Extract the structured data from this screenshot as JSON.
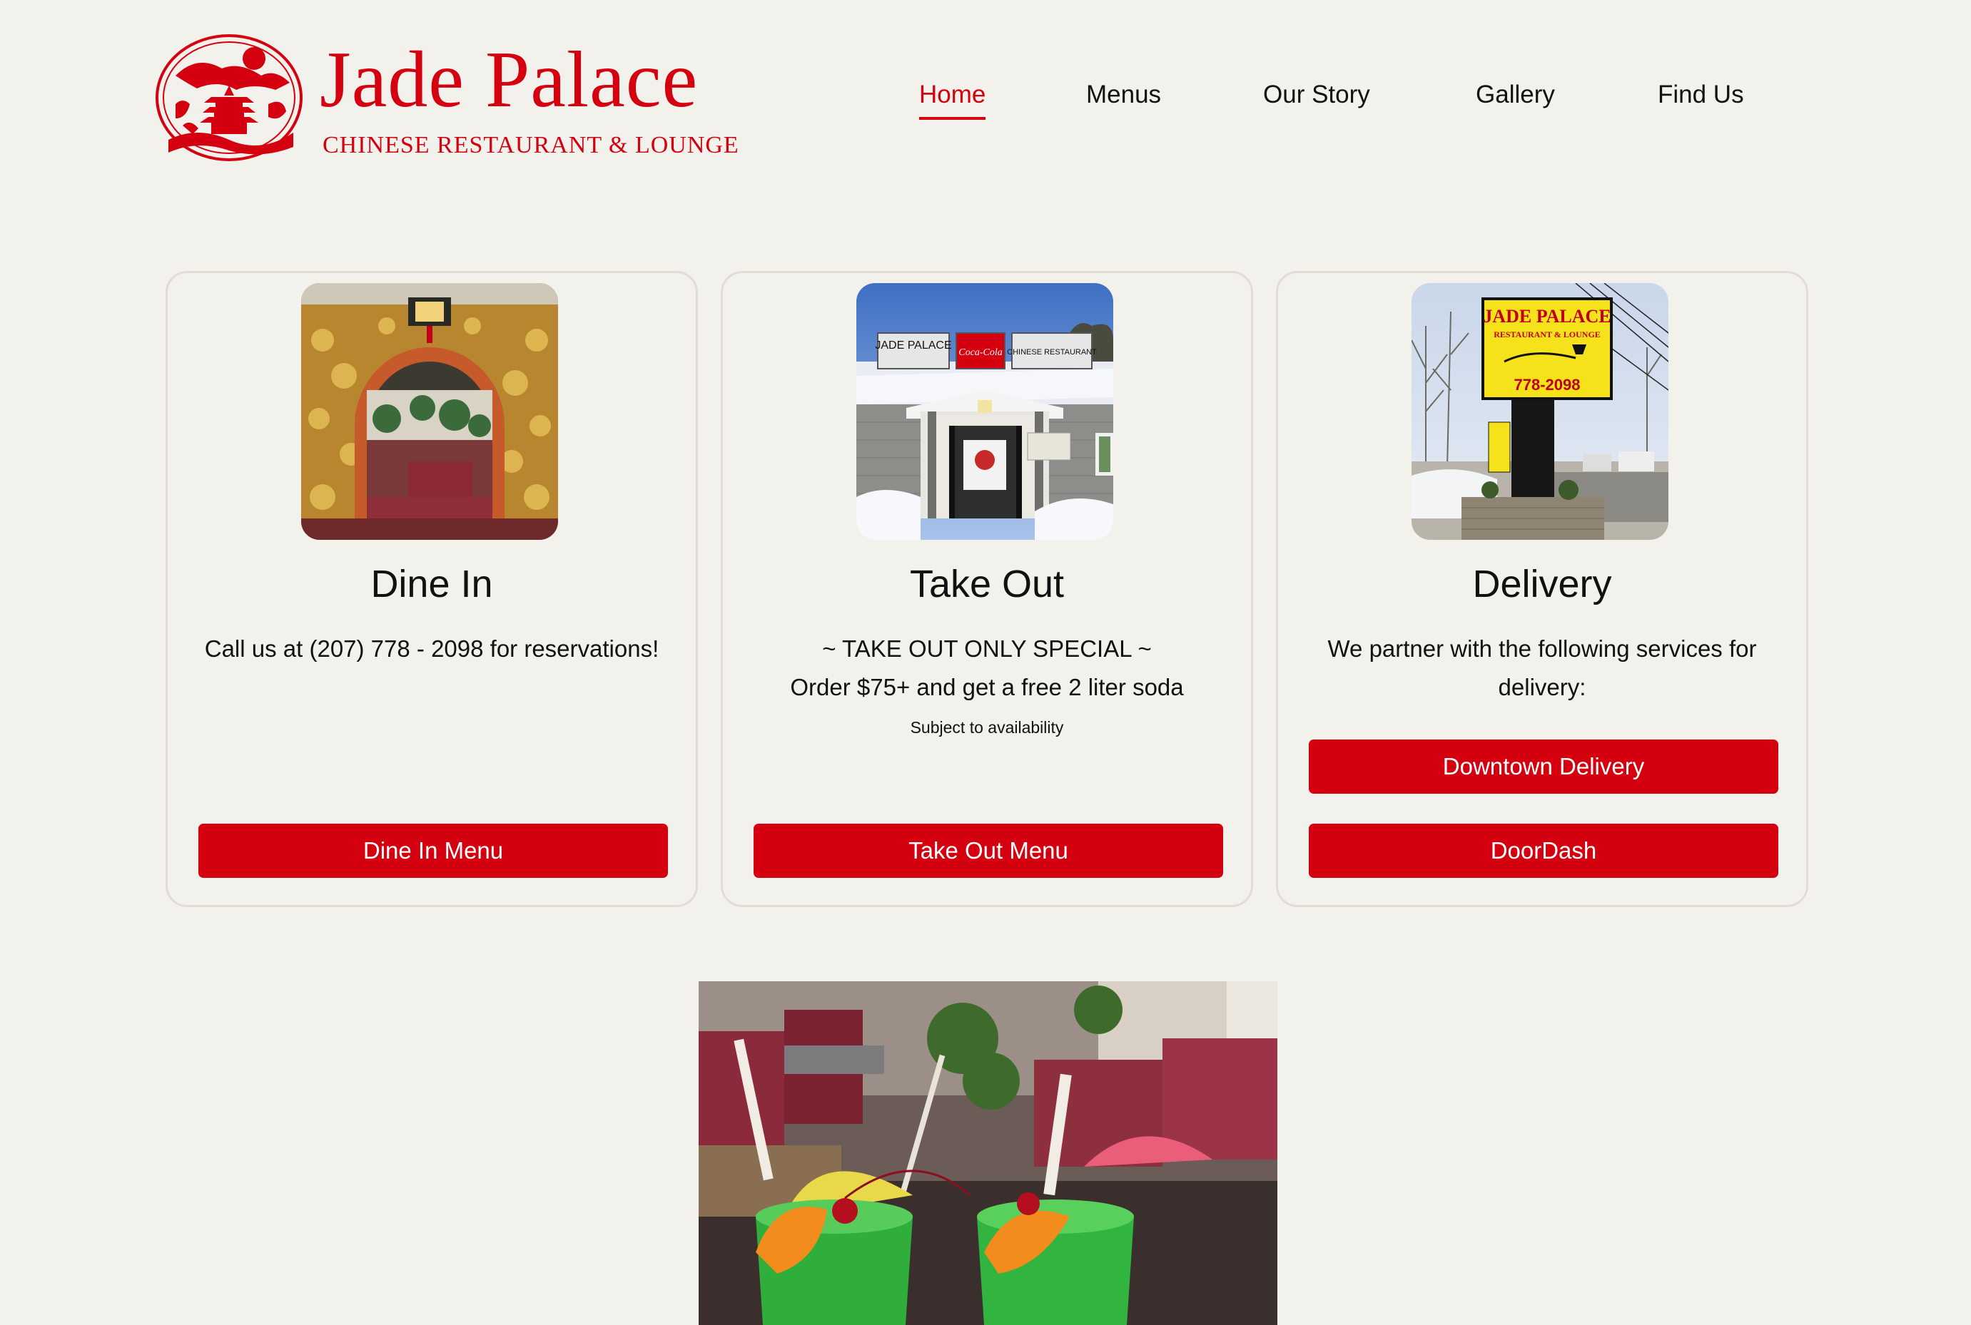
{
  "brand": {
    "name": "Jade Palace",
    "tagline": "CHINESE RESTAURANT & LOUNGE",
    "color": "#d4000f"
  },
  "nav": {
    "items": [
      {
        "label": "Home",
        "active": true
      },
      {
        "label": "Menus",
        "active": false
      },
      {
        "label": "Our Story",
        "active": false
      },
      {
        "label": "Gallery",
        "active": false
      },
      {
        "label": "Find Us",
        "active": false
      }
    ]
  },
  "cards": {
    "dine_in": {
      "title": "Dine In",
      "text": "Call us at (207) 778 - 2098 for reservations!",
      "button": "Dine In Menu"
    },
    "take_out": {
      "title": "Take Out",
      "line1": "~ TAKE OUT ONLY SPECIAL ~",
      "line2": "Order $75+ and get a free 2 liter soda",
      "note": "Subject to availability",
      "button": "Take Out Menu"
    },
    "delivery": {
      "title": "Delivery",
      "text": "We partner with the following services for delivery:",
      "buttons": [
        "Downtown Delivery",
        "DoorDash"
      ]
    }
  },
  "photos": {
    "take_out_sign": {
      "left_panel": "JADE PALACE",
      "center_panel": "Coca-Cola",
      "right_panel": "CHINESE RESTAURANT"
    },
    "delivery_sign": {
      "name": "JADE PALACE",
      "subtitle": "RESTAURANT & LOUNGE",
      "phone": "778-2098"
    }
  }
}
